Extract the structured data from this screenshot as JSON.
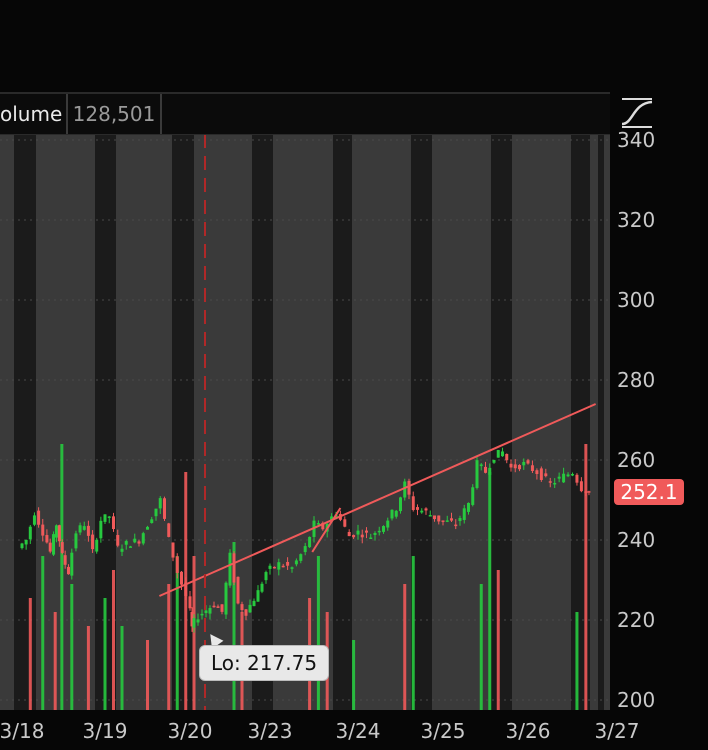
{
  "header": {
    "volume_label": "olume",
    "volume_value": "128,501"
  },
  "last_price_tag": {
    "text": "252.1",
    "color": "#f05a5a"
  },
  "low_tooltip": {
    "text": "Lo: 217.75"
  },
  "icons": {
    "drawing_tool": "curve-tool-icon"
  },
  "colors": {
    "up": "#27c93f",
    "down": "#f05a5a",
    "trendline": "#f05a5a",
    "session_band": "#3a3a3a",
    "offhours_band": "#1b1b1b"
  },
  "chart_data": {
    "type": "line",
    "subtype": "candlestick_with_volume",
    "x_ticks": [
      "3/18",
      "3/19",
      "3/20",
      "3/23",
      "3/24",
      "3/25",
      "3/26",
      "3/27"
    ],
    "y_ticks": [
      340,
      320,
      300,
      280,
      260,
      240,
      220,
      200
    ],
    "ylim": [
      200,
      342
    ],
    "last_price": 252.1,
    "low": 217.75,
    "grid": true,
    "price_series": [
      {
        "t": 0,
        "p": 238
      },
      {
        "t": 0.1,
        "p": 240
      },
      {
        "t": 0.2,
        "p": 247
      },
      {
        "t": 0.3,
        "p": 242
      },
      {
        "t": 0.38,
        "p": 237
      },
      {
        "t": 0.45,
        "p": 244
      },
      {
        "t": 0.52,
        "p": 236
      },
      {
        "t": 0.6,
        "p": 232
      },
      {
        "t": 0.7,
        "p": 242
      },
      {
        "t": 0.8,
        "p": 244
      },
      {
        "t": 0.9,
        "p": 237
      },
      {
        "t": 1.0,
        "p": 245
      },
      {
        "t": 1.1,
        "p": 246
      },
      {
        "t": 1.2,
        "p": 238
      },
      {
        "t": 1.3,
        "p": 239
      },
      {
        "t": 1.45,
        "p": 240
      },
      {
        "t": 1.6,
        "p": 246
      },
      {
        "t": 1.7,
        "p": 250
      },
      {
        "t": 1.8,
        "p": 240
      },
      {
        "t": 1.9,
        "p": 232
      },
      {
        "t": 2.0,
        "p": 226
      },
      {
        "t": 2.05,
        "p": 218
      },
      {
        "t": 2.15,
        "p": 221
      },
      {
        "t": 2.35,
        "p": 224
      },
      {
        "t": 2.45,
        "p": 222
      },
      {
        "t": 2.55,
        "p": 236
      },
      {
        "t": 2.65,
        "p": 224
      },
      {
        "t": 2.75,
        "p": 222
      },
      {
        "t": 2.9,
        "p": 227
      },
      {
        "t": 3.0,
        "p": 232
      },
      {
        "t": 3.15,
        "p": 234
      },
      {
        "t": 3.3,
        "p": 233
      },
      {
        "t": 3.45,
        "p": 238
      },
      {
        "t": 3.55,
        "p": 244
      },
      {
        "t": 3.65,
        "p": 243
      },
      {
        "t": 3.8,
        "p": 247
      },
      {
        "t": 3.95,
        "p": 241
      },
      {
        "t": 4.05,
        "p": 242
      },
      {
        "t": 4.2,
        "p": 241
      },
      {
        "t": 4.35,
        "p": 244
      },
      {
        "t": 4.5,
        "p": 248
      },
      {
        "t": 4.6,
        "p": 254
      },
      {
        "t": 4.7,
        "p": 248
      },
      {
        "t": 4.85,
        "p": 247
      },
      {
        "t": 5.0,
        "p": 245
      },
      {
        "t": 5.2,
        "p": 244
      },
      {
        "t": 5.35,
        "p": 249
      },
      {
        "t": 5.45,
        "p": 259
      },
      {
        "t": 5.55,
        "p": 257
      },
      {
        "t": 5.65,
        "p": 261
      },
      {
        "t": 5.75,
        "p": 262
      },
      {
        "t": 5.85,
        "p": 258
      },
      {
        "t": 6.0,
        "p": 259
      },
      {
        "t": 6.15,
        "p": 257
      },
      {
        "t": 6.3,
        "p": 254
      },
      {
        "t": 6.45,
        "p": 256
      },
      {
        "t": 6.55,
        "p": 257
      },
      {
        "t": 6.65,
        "p": 253
      },
      {
        "t": 6.72,
        "p": 252.1
      }
    ],
    "trendlines": [
      {
        "from": {
          "t": 1.64,
          "p": 226
        },
        "to": {
          "t": 6.76,
          "p": 274
        }
      },
      {
        "from": {
          "t": 3.48,
          "p": 237
        },
        "to": {
          "t": 3.8,
          "p": 248
        }
      }
    ],
    "volume_series": [
      {
        "t": 0.1,
        "v": 0.4,
        "up": false
      },
      {
        "t": 0.25,
        "v": 0.55,
        "up": true
      },
      {
        "t": 0.4,
        "v": 0.35,
        "up": false
      },
      {
        "t": 0.48,
        "v": 0.95,
        "up": true
      },
      {
        "t": 0.6,
        "v": 0.45,
        "up": true
      },
      {
        "t": 0.8,
        "v": 0.3,
        "up": false
      },
      {
        "t": 1.0,
        "v": 0.4,
        "up": true
      },
      {
        "t": 1.1,
        "v": 0.5,
        "up": false
      },
      {
        "t": 1.2,
        "v": 0.3,
        "up": true
      },
      {
        "t": 1.5,
        "v": 0.25,
        "up": false
      },
      {
        "t": 1.75,
        "v": 0.45,
        "up": false
      },
      {
        "t": 1.85,
        "v": 0.55,
        "up": true
      },
      {
        "t": 1.95,
        "v": 0.85,
        "up": false
      },
      {
        "t": 2.05,
        "v": 0.55,
        "up": false
      },
      {
        "t": 2.55,
        "v": 0.6,
        "up": true
      },
      {
        "t": 2.65,
        "v": 0.35,
        "up": false
      },
      {
        "t": 3.45,
        "v": 0.4,
        "up": false
      },
      {
        "t": 3.55,
        "v": 0.55,
        "up": true
      },
      {
        "t": 3.65,
        "v": 0.35,
        "up": false
      },
      {
        "t": 3.95,
        "v": 0.25,
        "up": true
      },
      {
        "t": 4.55,
        "v": 0.45,
        "up": false
      },
      {
        "t": 4.65,
        "v": 0.55,
        "up": true
      },
      {
        "t": 5.45,
        "v": 0.45,
        "up": true
      },
      {
        "t": 5.55,
        "v": 0.85,
        "up": true
      },
      {
        "t": 5.65,
        "v": 0.5,
        "up": false
      },
      {
        "t": 6.55,
        "v": 0.35,
        "up": true
      },
      {
        "t": 6.65,
        "v": 0.95,
        "up": false
      }
    ]
  }
}
